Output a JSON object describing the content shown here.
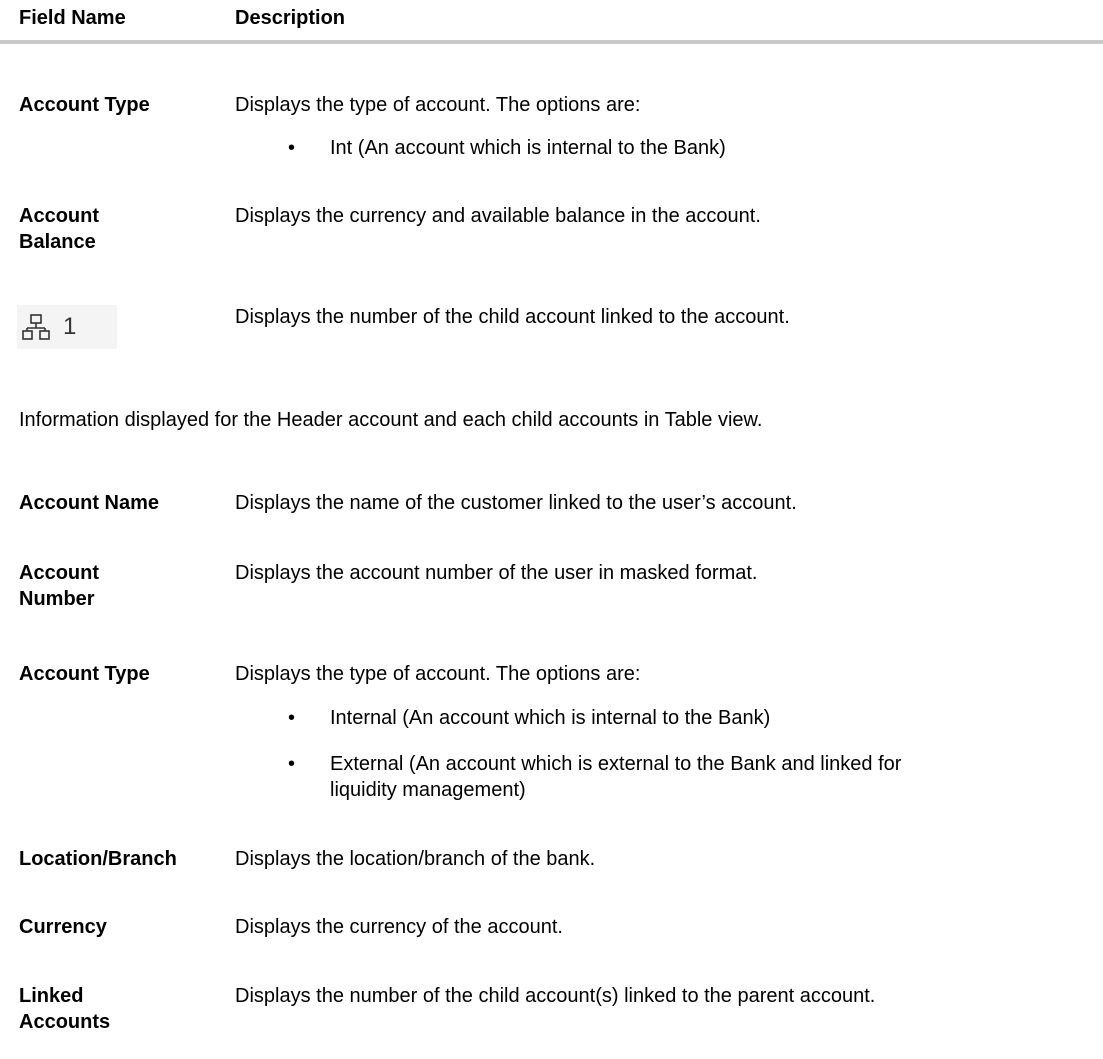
{
  "header": {
    "field_name": "Field Name",
    "description": "Description"
  },
  "section1": {
    "account_type": {
      "label": "Account Type",
      "desc": "Displays the type of account. The options are:",
      "options": [
        "Int (An account which is internal to the Bank)"
      ]
    },
    "account_balance": {
      "label_line1": "Account",
      "label_line2": "Balance",
      "desc": "Displays the currency and available balance in the account."
    },
    "linked_icon": {
      "icon": "hierarchy-icon",
      "count": "1",
      "desc": "Displays the number of the child account linked to the account."
    }
  },
  "note": "Information displayed for the Header account and each child accounts in Table view.",
  "section2": {
    "account_name": {
      "label": "Account Name",
      "desc": "Displays the name of the customer linked to the user’s account."
    },
    "account_number": {
      "label_line1": "Account",
      "label_line2": "Number",
      "desc": "Displays the account number of the user in masked format."
    },
    "account_type": {
      "label": "Account Type",
      "desc": "Displays the type of account. The options are:",
      "options": [
        "Internal (An account which is internal to the Bank)",
        "External (An account which is external to the Bank and linked for",
        "liquidity management)"
      ]
    },
    "location": {
      "label": "Location/Branch",
      "desc": "Displays the location/branch of the bank."
    },
    "currency": {
      "label": "Currency",
      "desc": "Displays the currency of the account."
    },
    "linked_accounts": {
      "label_line1": "Linked",
      "label_line2": "Accounts",
      "desc": "Displays the number of the child account(s) linked to the parent account."
    }
  }
}
